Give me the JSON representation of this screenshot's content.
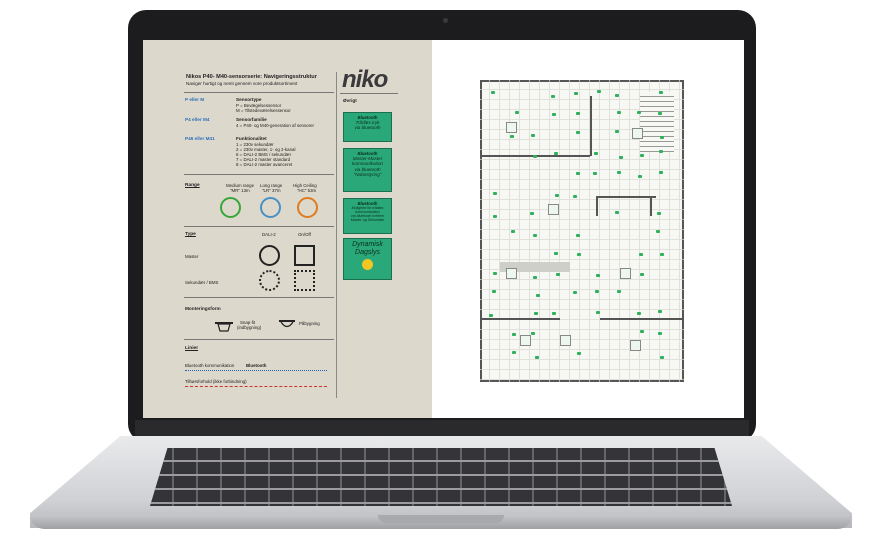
{
  "header": {
    "title": "Nikos P40- M40-sensorserie: Navigeringsstruktur",
    "subtitle": "Naviger hurtigt og nemt gennem vore produktsortiment"
  },
  "brand": {
    "logo": "niko",
    "accent": "#2aa87a"
  },
  "codes": [
    {
      "code": "P eller M",
      "heading": "Sensortype",
      "lines": [
        "P = Bevægelsessensor",
        "M = Tilstedeværelsessensor"
      ]
    },
    {
      "code": "P4 eller M4",
      "heading": "Sensorfamilie",
      "lines": [
        "4 = P40- og M40-generation af sensorer"
      ]
    },
    {
      "code": "P46 eller M41",
      "heading": "Funktionalitet",
      "lines": [
        "1 = 230v sekundær",
        "2 = 230v master, 1- og 2-kanal",
        "6 = DALI-2 BMS / sekundær",
        "7 = DALI-2 master standard",
        "8 = DALI-2 master avanceret"
      ]
    }
  ],
  "range": {
    "label": "Range",
    "items": [
      {
        "name": "Medium range",
        "value": "\"MR\" 13m",
        "color": "#3aa63a"
      },
      {
        "name": "Long range",
        "value": "\"LR\" 37m",
        "color": "#4a90c2"
      },
      {
        "name": "High Ceiling",
        "value": "\"HC\" 53m",
        "color": "#e07a1f"
      }
    ]
  },
  "type": {
    "label": "Type",
    "col1": "DALI-2",
    "col2": "On/Off",
    "row1": "Master",
    "row2": "Sekundær / BMS"
  },
  "mounting": {
    "label": "Monteringsform",
    "opt1": "Snap-fit",
    "opt1b": "(indbygning)",
    "opt2": "Påbygning"
  },
  "lines": {
    "label": "Linier",
    "l1": "Bluetooth kommunikation",
    "l1b": "Bluetooth",
    "l2": "Tilhørsforhold (ikke forbindning)"
  },
  "ovrigt": {
    "label": "Øvrigt",
    "boxes": [
      {
        "tag": "Bluetooth",
        "text": [
          "Trådløs tryk",
          "via bluetooth"
        ]
      },
      {
        "tag": "Bluetooth",
        "text": [
          "Master-Master",
          "kommunikation",
          "via bluetooth",
          "\"Nabostyring\""
        ]
      },
      {
        "tag": "Bluetooth",
        "text": [
          "Mulighed for trådløs",
          "kommunikation",
          "via bluetooth mellem",
          "Master og Sekundær"
        ]
      },
      {
        "tag": "",
        "text": [
          "Dynamisk",
          "Dagslys"
        ]
      }
    ]
  }
}
